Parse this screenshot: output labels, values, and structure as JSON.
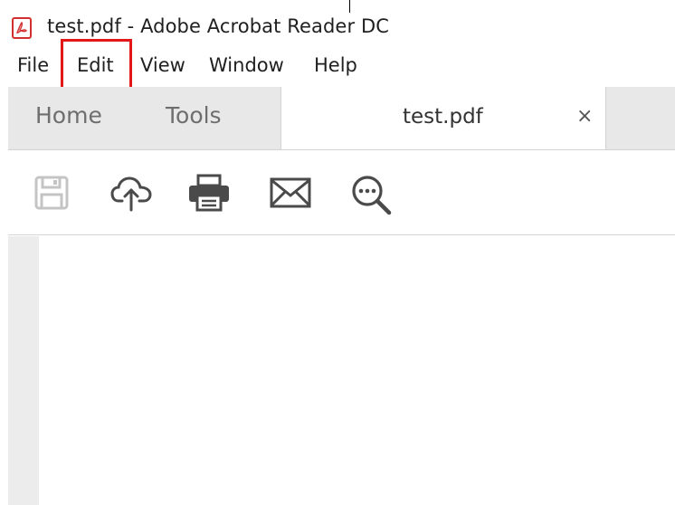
{
  "window": {
    "title": "test.pdf - Adobe Acrobat Reader DC",
    "app_icon": "acrobat-pdf-icon"
  },
  "menu": {
    "items": [
      "File",
      "Edit",
      "View",
      "Window",
      "Help"
    ],
    "highlighted": "Edit",
    "highlight_color": "#e21717"
  },
  "tabs": {
    "home": "Home",
    "tools": "Tools",
    "document": "test.pdf",
    "close": "×"
  },
  "toolbar": {
    "icons": [
      "save-icon",
      "cloud-upload-icon",
      "print-icon",
      "email-icon",
      "find-icon"
    ]
  }
}
